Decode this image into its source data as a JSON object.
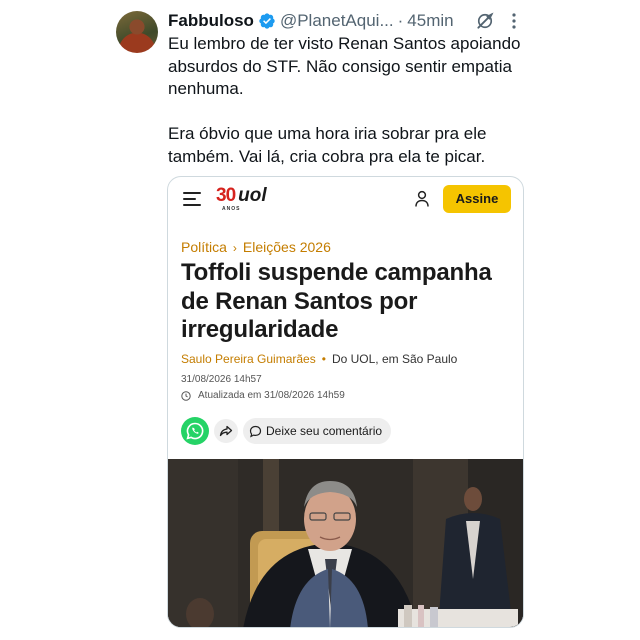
{
  "tweet": {
    "display_name": "Fabbuloso",
    "handle": "@PlanetAqui...",
    "separator": "·",
    "time": "45min",
    "text_paragraph_1": "Eu lembro de ter visto Renan Santos apoiando absurdos do STF. Não consigo sentir empatia nenhuma.",
    "text_paragraph_2": "Era óbvio que uma hora iria sobrar pra ele também. Vai lá, cria cobra pra ela te picar.",
    "verified_color": "#1d9bf0"
  },
  "uol": {
    "logo_30": "30",
    "logo_anos": "ANOS",
    "logo_uol": "uol",
    "subscribe_label": "Assine",
    "breadcrumb": [
      "Política",
      "Eleições 2026"
    ],
    "breadcrumb_separator": "›",
    "headline": "Toffoli suspende campanha de Renan Santos por irregularidade",
    "author": "Saulo Pereira Guimarães",
    "byline_separator": "•",
    "source": "Do UOL, em São Paulo",
    "published": "31/08/2026 14h57",
    "updated": "Atualizada em 31/08/2026 14h59",
    "comment_label": "Deixe seu comentário",
    "accent_color": "#c47d00",
    "brand_yellow": "#f5c400",
    "brand_red": "#d6231e"
  },
  "icons": [
    "verified-icon",
    "grok-icon",
    "more-icon",
    "menu-icon",
    "user-icon",
    "clock-icon",
    "whatsapp-icon",
    "share-icon",
    "comment-icon"
  ]
}
